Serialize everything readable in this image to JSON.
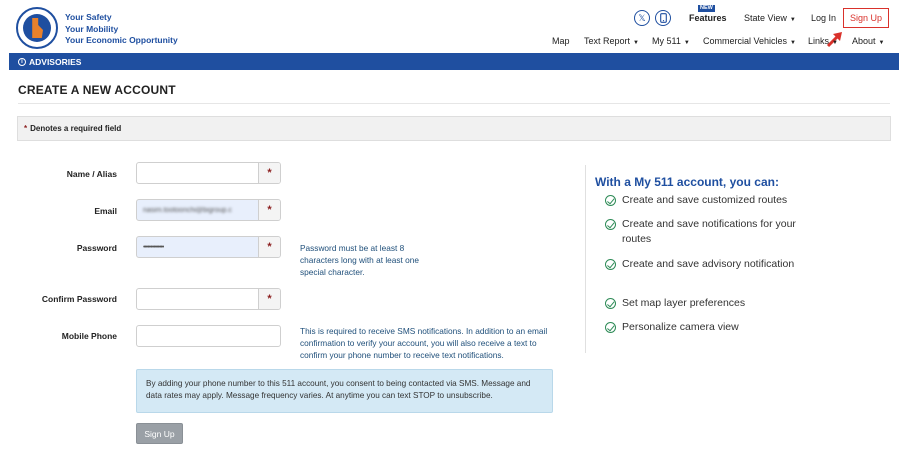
{
  "header": {
    "tagline": [
      "Your Safety",
      "Your Mobility",
      "Your Economic Opportunity"
    ],
    "new_badge": "NEW",
    "features": "Features",
    "state_view": "State View",
    "login": "Log In",
    "signup": "Sign Up",
    "social_icons": [
      "x-twitter-icon",
      "mobile-phone-icon"
    ]
  },
  "nav": [
    "Map",
    "Text Report",
    "My 511",
    "Commercial Vehicles",
    "Links",
    "About"
  ],
  "advisories": {
    "label": "ADVISORIES"
  },
  "page": {
    "title": "CREATE A NEW ACCOUNT",
    "required_note_star": "*",
    "required_note": "Denotes a required field"
  },
  "form": {
    "name_label": "Name / Alias",
    "name_value": "",
    "email_label": "Email",
    "email_value": "nasim.tootoonchi@bigroup.c",
    "password_label": "Password",
    "password_value": "••••••••••••••",
    "password_hint": "Password must be at least 8 characters long with at least one special character.",
    "confirm_label": "Confirm Password",
    "confirm_value": "",
    "mobile_label": "Mobile Phone",
    "mobile_value": "",
    "mobile_hint": "This is required to receive SMS notifications. In addition to an email confirmation to verify your account, you will also receive a text to confirm your phone number to receive text notifications.",
    "required_star": "*",
    "sms_notice": "By adding your phone number to this 511 account, you consent to being contacted via SMS. Message and data rates may apply. Message frequency varies. At anytime you can text STOP to unsubscribe.",
    "submit_label": "Sign Up"
  },
  "benefits": {
    "title": "With a My 511 account, you can:",
    "items": [
      "Create and save customized routes",
      "Create and save notifications for your routes",
      "Create and save advisory notification",
      "Set map layer preferences",
      "Personalize camera view"
    ]
  },
  "colors": {
    "brand": "#1f4fa0",
    "accent": "#d9312b",
    "success": "#2e8b57"
  }
}
